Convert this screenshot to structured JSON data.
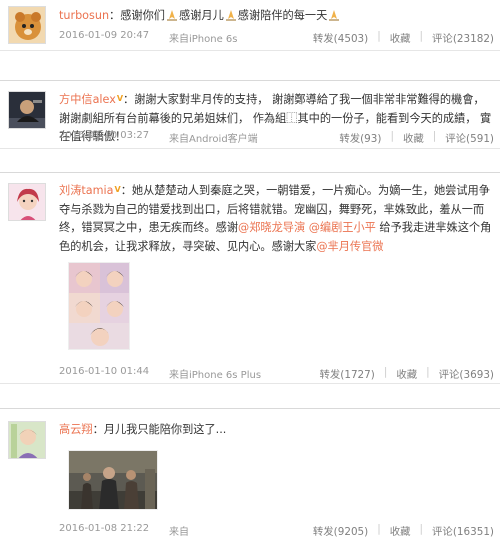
{
  "posts": [
    {
      "user": "turbosun",
      "text_before": "：感谢你们",
      "text_mid": "感谢月儿",
      "text_mid2": "感谢陪伴的每一天",
      "time": "2016-01-09 20:47",
      "source": "来自iPhone 6s",
      "repost": "转发(4503)",
      "fav": "收藏",
      "comment": "评论(23182)"
    },
    {
      "user": "方中信alex",
      "text": "：謝謝大家對芈月传的支持， 謝謝鄭導給了我一個非常非常難得的機會，謝謝劇組所有台前幕後的兄弟姐妹们， 作為組⿰其中的一份子，能看到今天的成績， 實在值得驕傲！",
      "time": "2016-01-10 03:27",
      "source": "来自Android客户端",
      "repost": "转发(93)",
      "fav": "收藏",
      "comment": "评论(591)"
    },
    {
      "user": "刘涛tamia",
      "text_1": "：她从楚楚动人到秦庭之哭，一朝错爱，一片痴心。为嫡一生，她尝试用争夺与杀戮为自己的错爱找到出口，后将错就错。宠幽囚，舞野死，芈姝致此，羞从一而终，错冥冥之中，患无疾而终。感谢",
      "mention_1": "@郑晓龙导演",
      "mention_2": "@编剧王小平",
      "text_2": " 给予我走进芈姝这个角色的机会，让我求释放，寻突破、见内心。感谢大家",
      "mention_3": "@芈月传官微",
      "time": "2016-01-10 01:44",
      "source": "来自iPhone 6s Plus",
      "repost": "转发(1727)",
      "fav": "收藏",
      "comment": "评论(3693)"
    },
    {
      "user": "高云翔",
      "text": "：月儿我只能陪你到这了...",
      "time": "2016-01-08 21:22",
      "source": "来自",
      "repost": "转发(9205)",
      "fav": "收藏",
      "comment": "评论(16351)"
    }
  ]
}
